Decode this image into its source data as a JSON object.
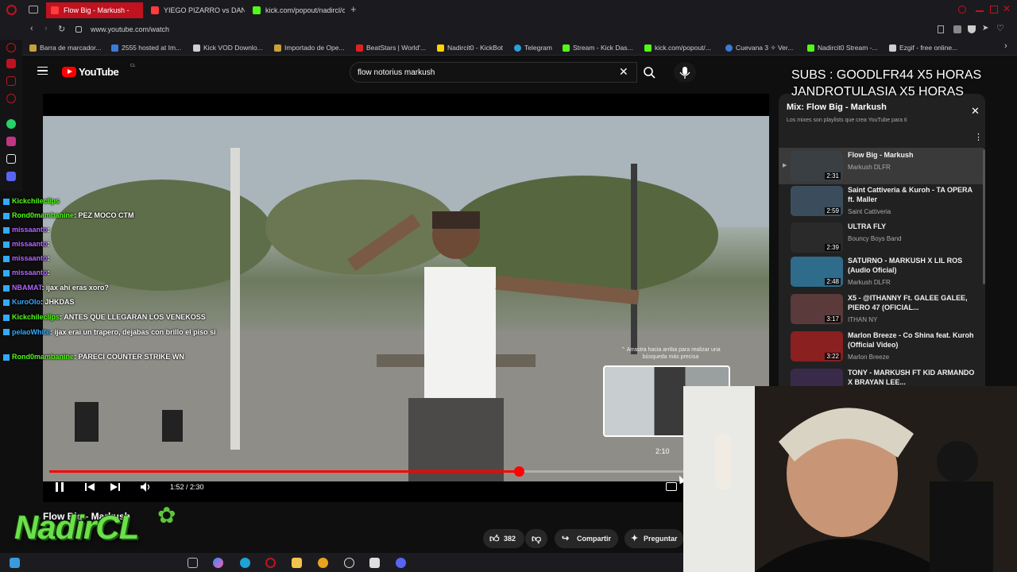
{
  "browser": {
    "tabs": [
      {
        "label": "Flow Big - Markush -",
        "active": true,
        "color": "#ff3b3b"
      },
      {
        "label": "YIEGO PIZARRO vs DANI",
        "active": false,
        "color": "#ff3b3b"
      },
      {
        "label": "kick.com/popout/nadircl/c",
        "active": false,
        "color": "#53fc18"
      }
    ],
    "url": "www.youtube.com/watch",
    "bookmarks": [
      {
        "label": "Barra de marcador...",
        "color": "#c8a13a"
      },
      {
        "label": "2555 hosted at Im...",
        "color": "#3b7bd8"
      },
      {
        "label": "Kick VOD Downlo...",
        "color": "#cfcfcf"
      },
      {
        "label": "Importado de Ope...",
        "color": "#c8a13a"
      },
      {
        "label": "BeatStars | World'...",
        "color": "#e02020"
      },
      {
        "label": "Nadircit0 - KickBot",
        "color": "#ffd400"
      },
      {
        "label": "Telegram",
        "color": "#2aa0da"
      },
      {
        "label": "Stream - Kick Das...",
        "color": "#53fc18"
      },
      {
        "label": "kick.com/popout/...",
        "color": "#53fc18"
      },
      {
        "label": "Cuevana 3 ✧ Ver...",
        "color": "#3b7bd8"
      },
      {
        "label": "Nadircit0 Stream -...",
        "color": "#53fc18"
      },
      {
        "label": "Ezgif - free online...",
        "color": "#cfcfcf"
      }
    ]
  },
  "youtube": {
    "logo_text": "YouTube",
    "logo_suffix": "CL",
    "search_value": "flow notorius markush",
    "player": {
      "time_current": "1:52",
      "time_sep": " / ",
      "time_total": "2:30",
      "progress": 0.74,
      "preview_time": "2:10",
      "seek_hint": "⌃ Arrastra hacia arriba para realizar una búsqueda más precisa"
    },
    "video_title_partial": "Flow Big - Markush",
    "likes": "382",
    "share_label": "Compartir",
    "ask_label": "Preguntar"
  },
  "overlay": {
    "line1": "SUBS : GOODLFR44 X5 HORAS",
    "line2": "JANDROTULASIA X5 HORAS",
    "logo_text": "NadirCL"
  },
  "mix": {
    "title": "Mix: Flow Big - Markush",
    "subtitle": "Los mixes son playlists que crea YouTube para ti",
    "items": [
      {
        "title": "Flow Big - Markush",
        "channel": "Markush DLFR",
        "duration": "2:31",
        "color": "#3a3f44"
      },
      {
        "title": "Saint Cattiveria & Kuroh - TA OPERA ft. Maller",
        "channel": "Saint Cattiveria",
        "duration": "2:59",
        "color": "#3b4d5c"
      },
      {
        "title": "ULTRA FLY",
        "channel": "Bouncy Boys Band",
        "duration": "2:39",
        "color": "#2a2a2a"
      },
      {
        "title": "SATURNO - MARKUSH X LIL ROS (Audio Oficial)",
        "channel": "Markush DLFR",
        "duration": "2:48",
        "color": "#2f6b8a"
      },
      {
        "title": "X5 - @ITHANNY Ft. GALEE GALEE, PIERO 47 (OFICIAL...",
        "channel": "ITHAN NY",
        "duration": "3:17",
        "color": "#5a3a3a"
      },
      {
        "title": "Marlon Breeze - Co Shina feat. Kuroh (Official Video)",
        "channel": "Marlon Breeze",
        "duration": "3:22",
        "color": "#8a2020"
      },
      {
        "title": "TONY - MARKUSH FT KID ARMANDO X BRAYAN LEE...",
        "channel": "",
        "duration": "",
        "color": "#3a2a4a"
      }
    ]
  },
  "chat": [
    {
      "user": "Kickchileclips",
      "text": "",
      "color": "#53fc18"
    },
    {
      "user": "Rond0mambanine",
      "text": "PEZ MOCO CTM",
      "color": "#53fc18"
    },
    {
      "user": "missaanto",
      "text": "",
      "color": "#b266ff"
    },
    {
      "user": "missaanto",
      "text": "",
      "color": "#b266ff"
    },
    {
      "user": "missaanto",
      "text": "",
      "color": "#b266ff"
    },
    {
      "user": "missaanto",
      "text": "",
      "color": "#b266ff"
    },
    {
      "user": "NBAMAT",
      "text": "ijax ahi eras xoro?",
      "color": "#b266ff"
    },
    {
      "user": "KuroOlo",
      "text": "JHKDAS",
      "color": "#33aaff"
    },
    {
      "user": "Kickchileclips",
      "text": "ANTES QUE LLEGARAN LOS VENEKOSS",
      "color": "#53fc18"
    },
    {
      "user": "pelaoWhite",
      "text": "ijax erai un trapero, dejabas con brillo el piso si",
      "color": "#33aaff"
    },
    {
      "user": "Rond0mambanine",
      "text": "PARECI COUNTER STRIKE WN",
      "color": "#53fc18"
    }
  ]
}
